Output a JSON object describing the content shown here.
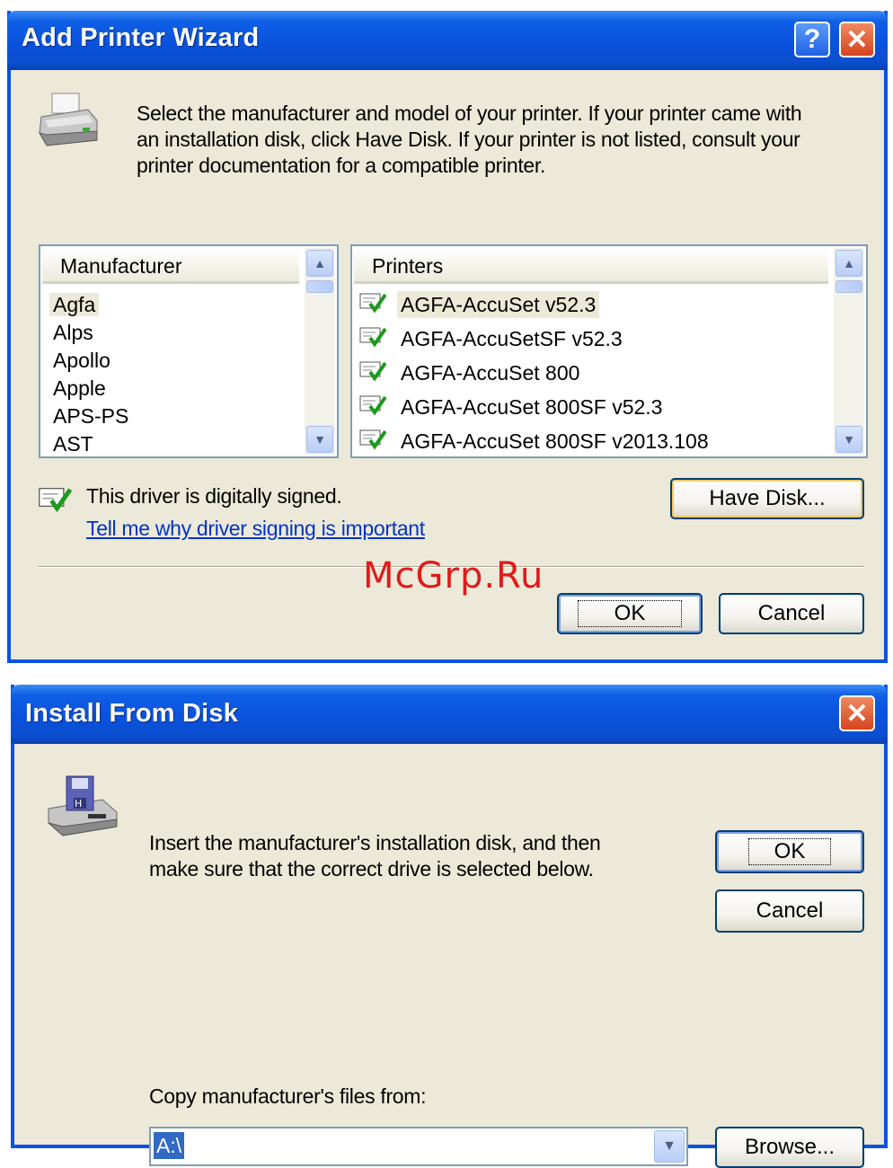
{
  "wizard": {
    "title": "Add Printer Wizard",
    "help_label": "?",
    "close_label": "✕",
    "instructions": [
      "Select the manufacturer and model of your printer. If your printer came with",
      "an installation disk, click Have Disk. If your printer is not listed, consult your",
      "printer documentation for a compatible printer."
    ],
    "manufacturer_list": {
      "header": "Manufacturer",
      "items": [
        "Agfa",
        "Alps",
        "Apollo",
        "Apple",
        "APS-PS",
        "AST"
      ],
      "selected": "Agfa"
    },
    "printers_list": {
      "header": "Printers",
      "items": [
        "AGFA-AccuSet v52.3",
        "AGFA-AccuSetSF v52.3",
        "AGFA-AccuSet 800",
        "AGFA-AccuSet 800SF v52.3",
        "AGFA-AccuSet 800SF v2013.108"
      ],
      "selected": "AGFA-AccuSet v52.3"
    },
    "signed_text": "This driver is digitally signed.",
    "signing_link": "Tell me why driver signing is important",
    "have_disk_label": "Have Disk...",
    "ok_label": "OK",
    "cancel_label": "Cancel"
  },
  "watermark": "McGrp.Ru",
  "install_dialog": {
    "title": "Install From Disk",
    "close_label": "✕",
    "instructions": [
      "Insert the manufacturer's installation disk, and then",
      "make sure that the correct drive is selected below."
    ],
    "ok_label": "OK",
    "cancel_label": "Cancel",
    "copy_label": "Copy manufacturer's files from:",
    "path_value": "A:\\",
    "browse_label": "Browse..."
  },
  "colors": {
    "titlebar": "#0a52dc",
    "dialog_bg": "#ece9d8",
    "close_button": "#d5441e",
    "link": "#0033cc",
    "watermark": "#e11a1a",
    "selection": "#316ac5"
  }
}
